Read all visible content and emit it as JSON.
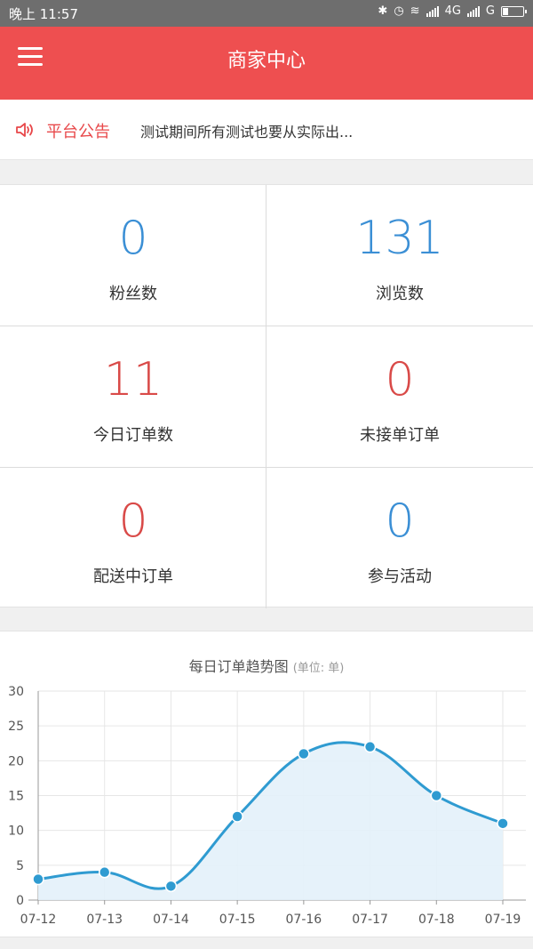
{
  "status_bar": {
    "time": "晚上 11:57",
    "network_1": "4G",
    "network_2": "G"
  },
  "header": {
    "title": "商家中心",
    "menu_icon": "hamburger-menu-icon",
    "color": "#ee4f50"
  },
  "notice": {
    "icon": "speaker-icon",
    "label": "平台公告",
    "text": "测试期间所有测试也要从实际出..."
  },
  "stats": [
    {
      "value": "0",
      "label": "粉丝数",
      "color": "#3b8fd5"
    },
    {
      "value": "131",
      "label": "浏览数",
      "color": "#3b8fd5"
    },
    {
      "value": "11",
      "label": "今日订单数",
      "color": "#d94a48"
    },
    {
      "value": "0",
      "label": "未接单订单",
      "color": "#d94a48"
    },
    {
      "value": "0",
      "label": "配送中订单",
      "color": "#d94a48"
    },
    {
      "value": "0",
      "label": "参与活动",
      "color": "#3b8fd5"
    }
  ],
  "chart": {
    "title": "每日订单趋势图",
    "unit": "(单位: 单)"
  },
  "chart_data": {
    "type": "area",
    "title": "每日订单趋势图",
    "subtitle": "(单位: 单)",
    "categories": [
      "07-12",
      "07-13",
      "07-14",
      "07-15",
      "07-16",
      "07-17",
      "07-18",
      "07-19"
    ],
    "values": [
      3,
      4,
      2,
      12,
      21,
      22,
      15,
      11
    ],
    "ylim": [
      0,
      30
    ],
    "yticks": [
      "0",
      "5",
      "10",
      "15",
      "20",
      "25",
      "30"
    ],
    "grid": true,
    "smooth": true,
    "line_color": "#2f9bd1",
    "fill_color": "#e3f1fa"
  }
}
